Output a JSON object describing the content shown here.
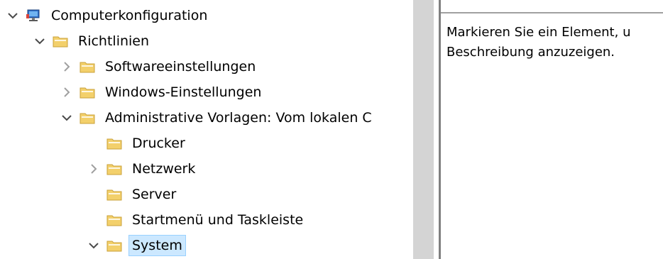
{
  "tree": {
    "items": [
      {
        "label": "Computerkonfiguration",
        "icon": "computer-icon",
        "expander": "expanded"
      },
      {
        "label": "Richtlinien",
        "icon": "folder-icon",
        "expander": "expanded"
      },
      {
        "label": "Softwareeinstellungen",
        "icon": "folder-icon",
        "expander": "collapsed"
      },
      {
        "label": "Windows-Einstellungen",
        "icon": "folder-icon",
        "expander": "collapsed"
      },
      {
        "label": "Administrative Vorlagen: Vom lokalen C",
        "icon": "folder-icon",
        "expander": "expanded"
      },
      {
        "label": "Drucker",
        "icon": "folder-icon",
        "expander": "none"
      },
      {
        "label": "Netzwerk",
        "icon": "folder-icon",
        "expander": "collapsed"
      },
      {
        "label": "Server",
        "icon": "folder-icon",
        "expander": "none"
      },
      {
        "label": "Startmenü und Taskleiste",
        "icon": "folder-icon",
        "expander": "none"
      },
      {
        "label": "System",
        "icon": "folder-icon",
        "expander": "expanded",
        "selected": true
      }
    ]
  },
  "description": {
    "line1": "Markieren Sie ein Element, u",
    "line2": "Beschreibung anzuzeigen."
  },
  "colors": {
    "selection": "#cce8ff",
    "selection_border": "#99d1ff",
    "splitter": "#d4d4d4",
    "folder": "#f3d06b"
  }
}
